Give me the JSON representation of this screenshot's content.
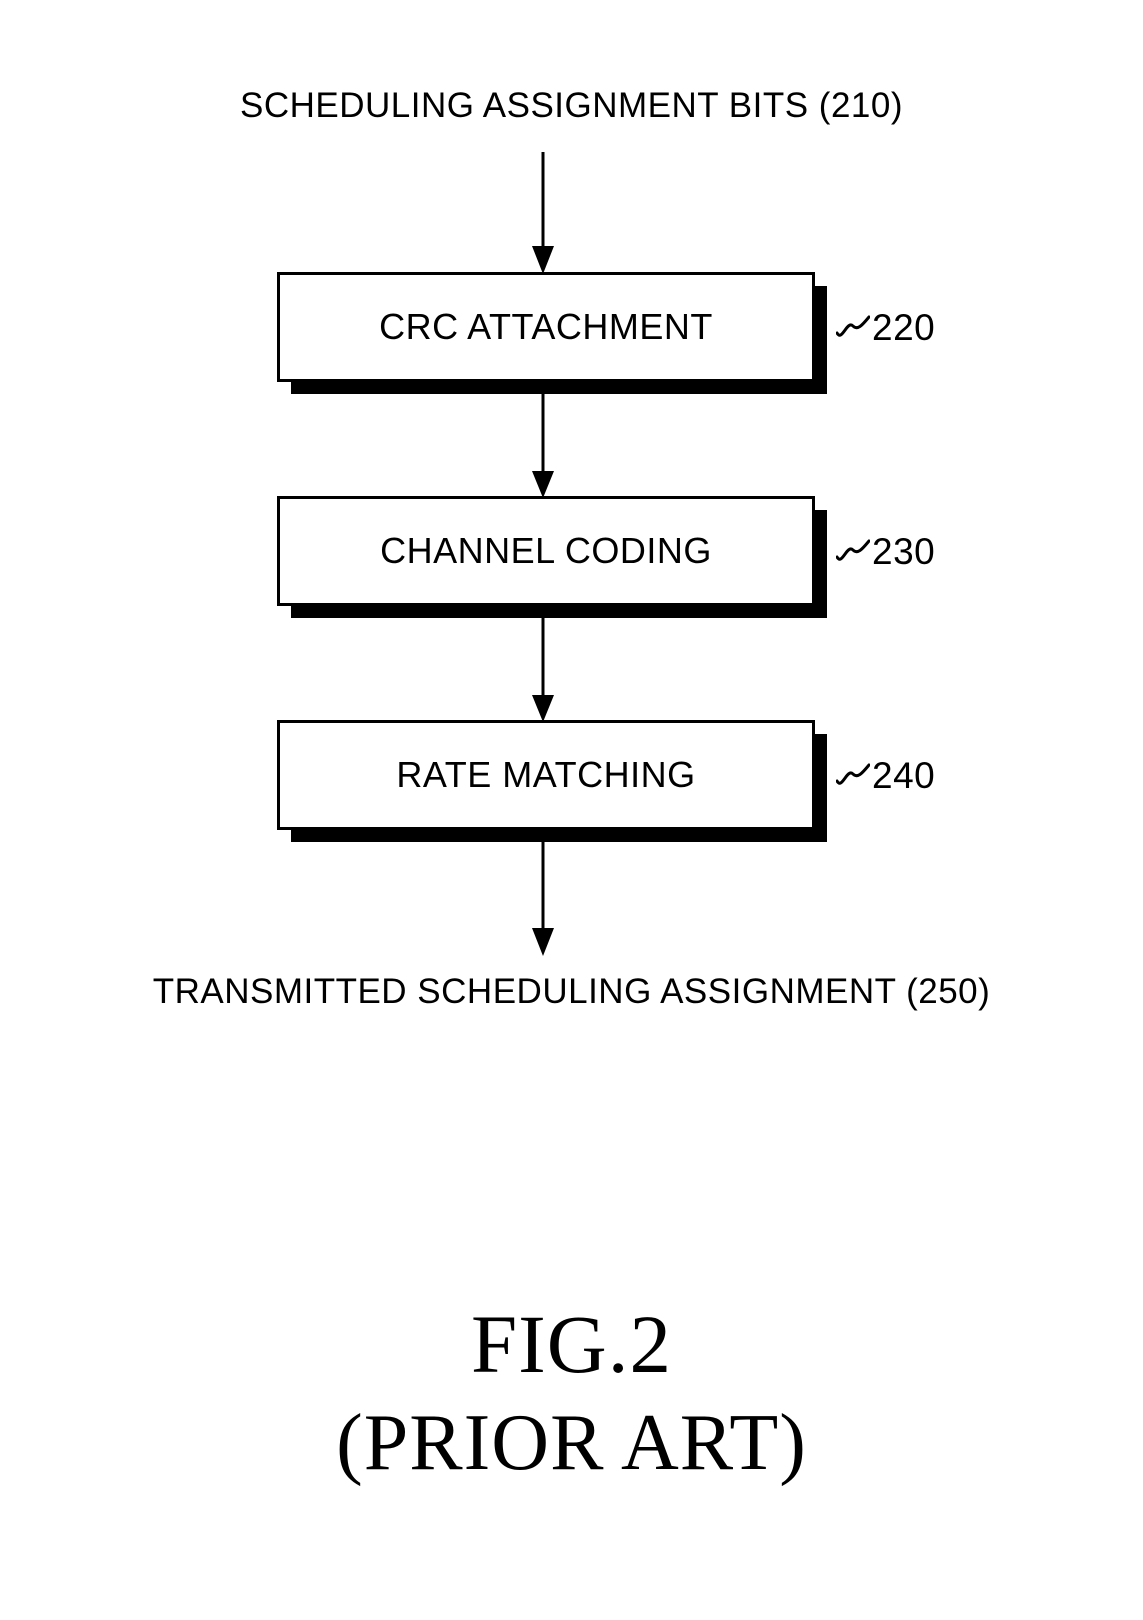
{
  "figure": {
    "title": "FIG.2",
    "subtitle": "(PRIOR ART)"
  },
  "flow": {
    "input_label": "SCHEDULING ASSIGNMENT BITS (210)",
    "output_label": "TRANSMITTED SCHEDULING ASSIGNMENT (250)",
    "steps": [
      {
        "label": "CRC ATTACHMENT",
        "ref": "220"
      },
      {
        "label": "CHANNEL CODING",
        "ref": "230"
      },
      {
        "label": "RATE MATCHING",
        "ref": "240"
      }
    ],
    "arrows": [
      {
        "name": "input-to-crc"
      },
      {
        "name": "crc-to-channel"
      },
      {
        "name": "channel-to-rate"
      },
      {
        "name": "rate-to-output"
      }
    ]
  },
  "colors": {
    "ink": "#000000",
    "paper": "#ffffff"
  }
}
